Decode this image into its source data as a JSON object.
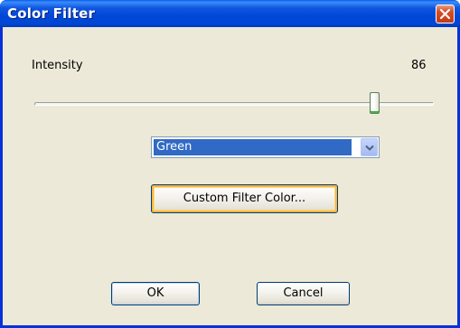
{
  "window": {
    "title": "Color Filter",
    "close_icon": "close-x-icon"
  },
  "intensity": {
    "label": "Intensity",
    "value": "86",
    "min": 0,
    "max": 100,
    "level": 86
  },
  "color_select": {
    "selected": "Green",
    "arrow_icon": "chevron-down-icon"
  },
  "buttons": {
    "custom_color": "Custom Filter Color...",
    "ok": "OK",
    "cancel": "Cancel"
  },
  "colors": {
    "titlebar": "#0047d6",
    "client_bg": "#ece9d8",
    "selection": "#316ac5",
    "close_button": "#c43a12",
    "focus_highlight": "#f8b83c"
  }
}
